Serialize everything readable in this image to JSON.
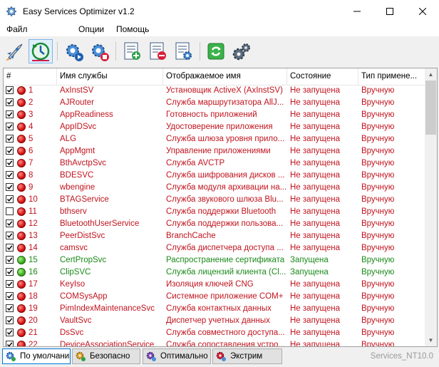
{
  "window": {
    "title": "Easy Services Optimizer v1.2",
    "minimize": "—",
    "maximize": "☐",
    "close": "✕"
  },
  "menu": [
    "Файл",
    "Опции",
    "Помощь"
  ],
  "toolbar": {
    "icons": [
      "optimize-rocket-icon",
      "restore-defaults-icon",
      "start-service-icon",
      "stop-service-icon",
      "add-list-icon",
      "remove-list-icon",
      "edit-list-icon",
      "refresh-icon",
      "services-icon"
    ]
  },
  "table": {
    "columns": [
      "#",
      "Имя службы",
      "Отображаемое имя",
      "Состояние",
      "Тип примене..."
    ],
    "rows": [
      {
        "checked": true,
        "status": "stopped",
        "num": "1",
        "name": "AxInstSV",
        "display": "Установщик ActiveX (AxInstSV)",
        "state": "Не запущена",
        "type": "Вручную"
      },
      {
        "checked": true,
        "status": "stopped",
        "num": "2",
        "name": "AJRouter",
        "display": "Служба маршрутизатора AllJ...",
        "state": "Не запущена",
        "type": "Вручную"
      },
      {
        "checked": true,
        "status": "stopped",
        "num": "3",
        "name": "AppReadiness",
        "display": "Готовность приложений",
        "state": "Не запущена",
        "type": "Вручную"
      },
      {
        "checked": true,
        "status": "stopped",
        "num": "4",
        "name": "AppIDSvc",
        "display": "Удостоверение приложения",
        "state": "Не запущена",
        "type": "Вручную"
      },
      {
        "checked": true,
        "status": "stopped",
        "num": "5",
        "name": "ALG",
        "display": "Служба шлюза уровня прило...",
        "state": "Не запущена",
        "type": "Вручную"
      },
      {
        "checked": true,
        "status": "stopped",
        "num": "6",
        "name": "AppMgmt",
        "display": "Управление приложениями",
        "state": "Не запущена",
        "type": "Вручную"
      },
      {
        "checked": true,
        "status": "stopped",
        "num": "7",
        "name": "BthAvctpSvc",
        "display": "Служба AVCTP",
        "state": "Не запущена",
        "type": "Вручную"
      },
      {
        "checked": true,
        "status": "stopped",
        "num": "8",
        "name": "BDESVC",
        "display": "Служба шифрования дисков ...",
        "state": "Не запущена",
        "type": "Вручную"
      },
      {
        "checked": true,
        "status": "stopped",
        "num": "9",
        "name": "wbengine",
        "display": "Служба модуля архивации на...",
        "state": "Не запущена",
        "type": "Вручную"
      },
      {
        "checked": true,
        "status": "stopped",
        "num": "10",
        "name": "BTAGService",
        "display": "Служба звукового шлюза Blu...",
        "state": "Не запущена",
        "type": "Вручную"
      },
      {
        "checked": false,
        "status": "stopped",
        "num": "11",
        "name": "bthserv",
        "display": "Служба поддержки Bluetooth",
        "state": "Не запущена",
        "type": "Вручную"
      },
      {
        "checked": true,
        "status": "stopped",
        "num": "12",
        "name": "BluetoothUserService",
        "display": "Служба поддержки пользова...",
        "state": "Не запущена",
        "type": "Вручную"
      },
      {
        "checked": true,
        "status": "stopped",
        "num": "13",
        "name": "PeerDistSvc",
        "display": "BranchCache",
        "state": "Не запущена",
        "type": "Вручную"
      },
      {
        "checked": true,
        "status": "stopped",
        "num": "14",
        "name": "camsvc",
        "display": "Служба диспетчера доступа ...",
        "state": "Не запущена",
        "type": "Вручную"
      },
      {
        "checked": true,
        "status": "running",
        "num": "15",
        "name": "CertPropSvc",
        "display": "Распространение сертификата",
        "state": "Запущена",
        "type": "Вручную"
      },
      {
        "checked": true,
        "status": "running",
        "num": "16",
        "name": "ClipSVC",
        "display": "Служба лицензий клиента (Cl...",
        "state": "Запущена",
        "type": "Вручную"
      },
      {
        "checked": true,
        "status": "stopped",
        "num": "17",
        "name": "KeyIso",
        "display": "Изоляция ключей CNG",
        "state": "Не запущена",
        "type": "Вручную"
      },
      {
        "checked": true,
        "status": "stopped",
        "num": "18",
        "name": "COMSysApp",
        "display": "Системное приложение COM+",
        "state": "Не запущена",
        "type": "Вручную"
      },
      {
        "checked": true,
        "status": "stopped",
        "num": "19",
        "name": "PimIndexMaintenanceSvc",
        "display": "Служба контактных данных",
        "state": "Не запущена",
        "type": "Вручную"
      },
      {
        "checked": true,
        "status": "stopped",
        "num": "20",
        "name": "VaultSvc",
        "display": "Диспетчер учетных данных",
        "state": "Не запущена",
        "type": "Вручную"
      },
      {
        "checked": true,
        "status": "stopped",
        "num": "21",
        "name": "DsSvc",
        "display": "Служба совместного доступа...",
        "state": "Не запущена",
        "type": "Вручную"
      },
      {
        "checked": true,
        "status": "stopped",
        "num": "22",
        "name": "DeviceAssociationService",
        "display": "Служба сопоставления устро...",
        "state": "Не запущена",
        "type": "Вручную"
      }
    ]
  },
  "presets": [
    {
      "label": "По умолчанию",
      "active": true
    },
    {
      "label": "Безопасно",
      "active": false
    },
    {
      "label": "Оптимально",
      "active": false
    },
    {
      "label": "Экстрим",
      "active": false
    }
  ],
  "status_text": "Services_NT10.0",
  "colors": {
    "stopped_text": "#c0141e",
    "running_text": "#1a8a1a",
    "accent": "#0078d7"
  }
}
